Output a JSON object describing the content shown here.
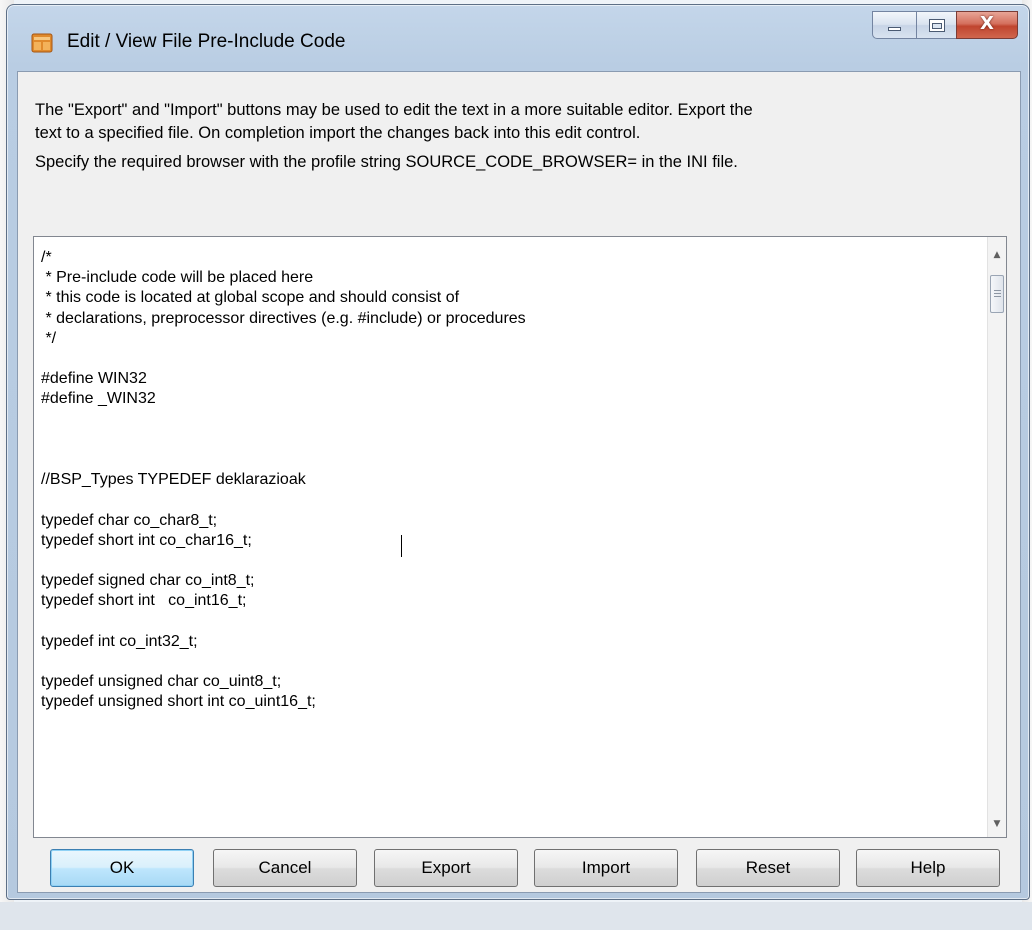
{
  "window": {
    "title": "Edit / View File Pre-Include Code",
    "close_symbol": "X",
    "icon": "app-window-icon"
  },
  "description": {
    "line1": "The \"Export\" and \"Import\" buttons may be used to edit the text in a more suitable editor. Export the",
    "line1b": "text to a specified file. On completion import the changes back into this edit control.",
    "line2": "Specify the required browser with the profile string SOURCE_CODE_BROWSER= in the INI file."
  },
  "editor": {
    "text": "/*\n * Pre-include code will be placed here\n * this code is located at global scope and should consist of\n * declarations, preprocessor directives (e.g. #include) or procedures\n */\n\n#define WIN32\n#define _WIN32\n\n\n\n//BSP_Types TYPEDEF deklarazioak\n\ntypedef char co_char8_t;\ntypedef short int co_char16_t;\n\ntypedef signed char co_int8_t;\ntypedef short int   co_int16_t;\n\ntypedef int co_int32_t;\n\ntypedef unsigned char co_uint8_t;\ntypedef unsigned short int co_uint16_t;"
  },
  "buttons": {
    "ok": "OK",
    "cancel": "Cancel",
    "export": "Export",
    "import": "Import",
    "reset": "Reset",
    "help": "Help"
  },
  "colors": {
    "default_button_border": "#3c7fb1",
    "close_button": "#c0452f",
    "titlebar": "#c4d6ea"
  }
}
